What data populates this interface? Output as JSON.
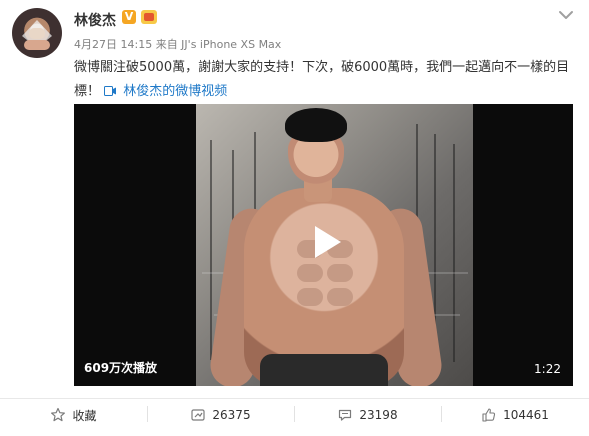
{
  "post": {
    "user_name": "林俊杰",
    "verified_badge": "V",
    "meta": "4月27日 14:15 来自 JJ's iPhone XS Max",
    "text": "微博關注破5000萬，謝謝大家的支持！下次，破6000萬時，我們一起邁向不一樣的目標！",
    "video_link_text": "林俊杰的微博视频",
    "video": {
      "view_count": "609万次播放",
      "duration": "1:22"
    }
  },
  "actions": {
    "favorite_label": "收藏",
    "repost_count": "26375",
    "comment_count": "23198",
    "like_count": "104461"
  },
  "colors": {
    "link": "#1f79c8",
    "verified": "#f5a623",
    "text": "#333333",
    "meta": "#808080"
  }
}
